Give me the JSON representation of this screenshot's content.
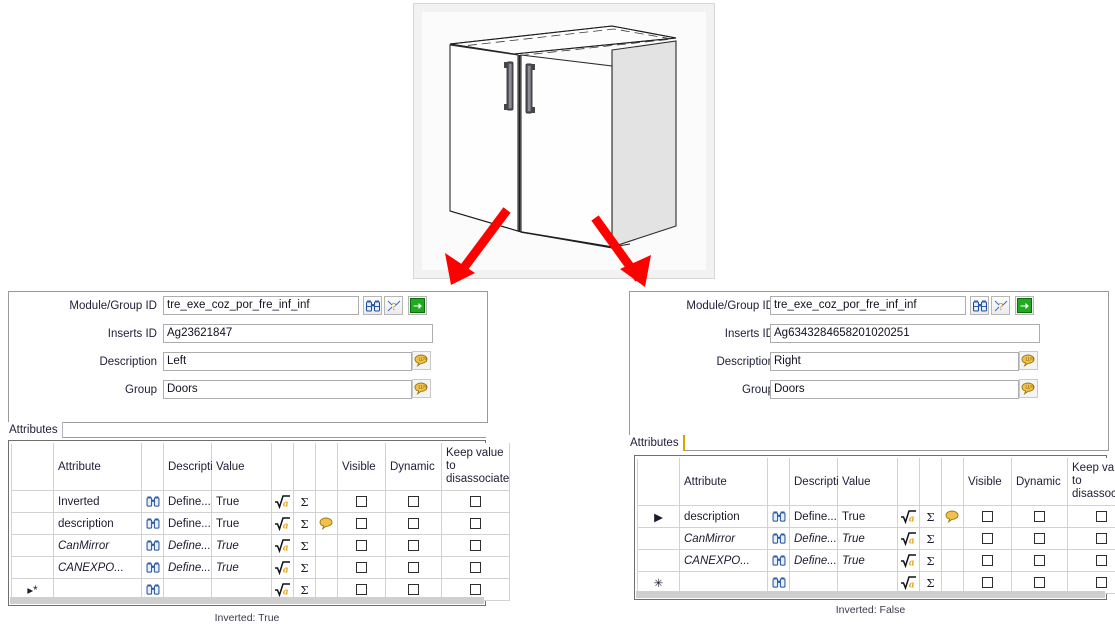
{
  "preview": {
    "alt_name": "cabinet-3d-preview",
    "annotation": "two red arrows pointing from the left and right cabinet doors down to the two property panels",
    "arrow_color": "#ff0000"
  },
  "panels": [
    {
      "id": "left",
      "fields": [
        {
          "label": "Module/Group ID",
          "value": "tre_exe_coz_por_fre_inf_inf",
          "buttons": [
            "binoculars-icon",
            "wand-icon",
            "green-arrow-icon"
          ]
        },
        {
          "label": "Inserts ID",
          "value": "Ag23621847",
          "buttons": []
        },
        {
          "label": "Description",
          "value": "Left",
          "buttons": [
            "comment-bubble-icon"
          ]
        },
        {
          "label": "Group",
          "value": "Doors",
          "buttons": [
            "comment-bubble-icon"
          ]
        }
      ],
      "tab": "Attributes",
      "grid": {
        "headers": [
          "",
          "Attribute",
          "",
          "Descripti",
          "Value",
          "",
          "",
          "",
          "Visible",
          "Dynamic",
          "Keep value to disassociate"
        ],
        "rows": [
          {
            "marker": "",
            "attribute": "Inverted",
            "description": "Define...",
            "value": "True",
            "dim": false,
            "selected": false,
            "comment": false,
            "visible": false,
            "dynamic": false,
            "keep": false
          },
          {
            "marker": "",
            "attribute": "description",
            "description": "Define...",
            "value": "True",
            "dim": false,
            "selected": false,
            "comment": true,
            "visible": false,
            "dynamic": false,
            "keep": false
          },
          {
            "marker": "",
            "attribute": "CanMirror",
            "description": "Define...",
            "value": "True",
            "dim": true,
            "selected": false,
            "comment": false,
            "visible": false,
            "dynamic": false,
            "keep": false
          },
          {
            "marker": "",
            "attribute": "CANEXPO...",
            "description": "Define...",
            "value": "True",
            "dim": true,
            "selected": false,
            "comment": false,
            "visible": false,
            "dynamic": false,
            "keep": false
          },
          {
            "marker": "▸*",
            "attribute": "",
            "description": "",
            "value": "",
            "dim": false,
            "selected": true,
            "comment": false,
            "visible": false,
            "dynamic": false,
            "keep": false
          }
        ]
      },
      "status": "Inverted: True"
    },
    {
      "id": "right",
      "fields": [
        {
          "label": "Module/Group ID",
          "value": "tre_exe_coz_por_fre_inf_inf",
          "buttons": [
            "binoculars-icon",
            "wand-icon",
            "green-arrow-icon"
          ]
        },
        {
          "label": "Inserts ID",
          "value": "Ag6343284658201020251",
          "buttons": []
        },
        {
          "label": "Description",
          "value": "Right",
          "buttons": [
            "comment-bubble-icon"
          ]
        },
        {
          "label": "Group",
          "value": "Doors",
          "buttons": [
            "comment-bubble-icon"
          ]
        }
      ],
      "tab": "Attributes",
      "grid": {
        "headers": [
          "",
          "Attribute",
          "",
          "Descripti",
          "Value",
          "",
          "",
          "",
          "Visible",
          "Dynamic",
          "Keep value to disassociate"
        ],
        "rows": [
          {
            "marker": "▶",
            "attribute": "description",
            "description": "Define...",
            "value": "True",
            "dim": false,
            "selected": true,
            "comment": true,
            "visible": false,
            "dynamic": false,
            "keep": false
          },
          {
            "marker": "",
            "attribute": "CanMirror",
            "description": "Define...",
            "value": "True",
            "dim": true,
            "selected": false,
            "comment": false,
            "visible": false,
            "dynamic": false,
            "keep": false
          },
          {
            "marker": "",
            "attribute": "CANEXPO...",
            "description": "Define...",
            "value": "True",
            "dim": true,
            "selected": false,
            "comment": false,
            "visible": false,
            "dynamic": false,
            "keep": false
          },
          {
            "marker": "✳",
            "attribute": "",
            "description": "",
            "value": "",
            "dim": false,
            "selected": false,
            "comment": false,
            "visible": false,
            "dynamic": false,
            "keep": false
          }
        ]
      },
      "status": "Inverted: False"
    }
  ],
  "colors": {
    "selection_blue": "#1683d8",
    "green_button": "#1faa1f",
    "comment_yellow": "#f2c14b",
    "binocular_blue": "#2b5fa8",
    "arrow_red": "#ff0000",
    "tab_accent": "#d8a400"
  }
}
